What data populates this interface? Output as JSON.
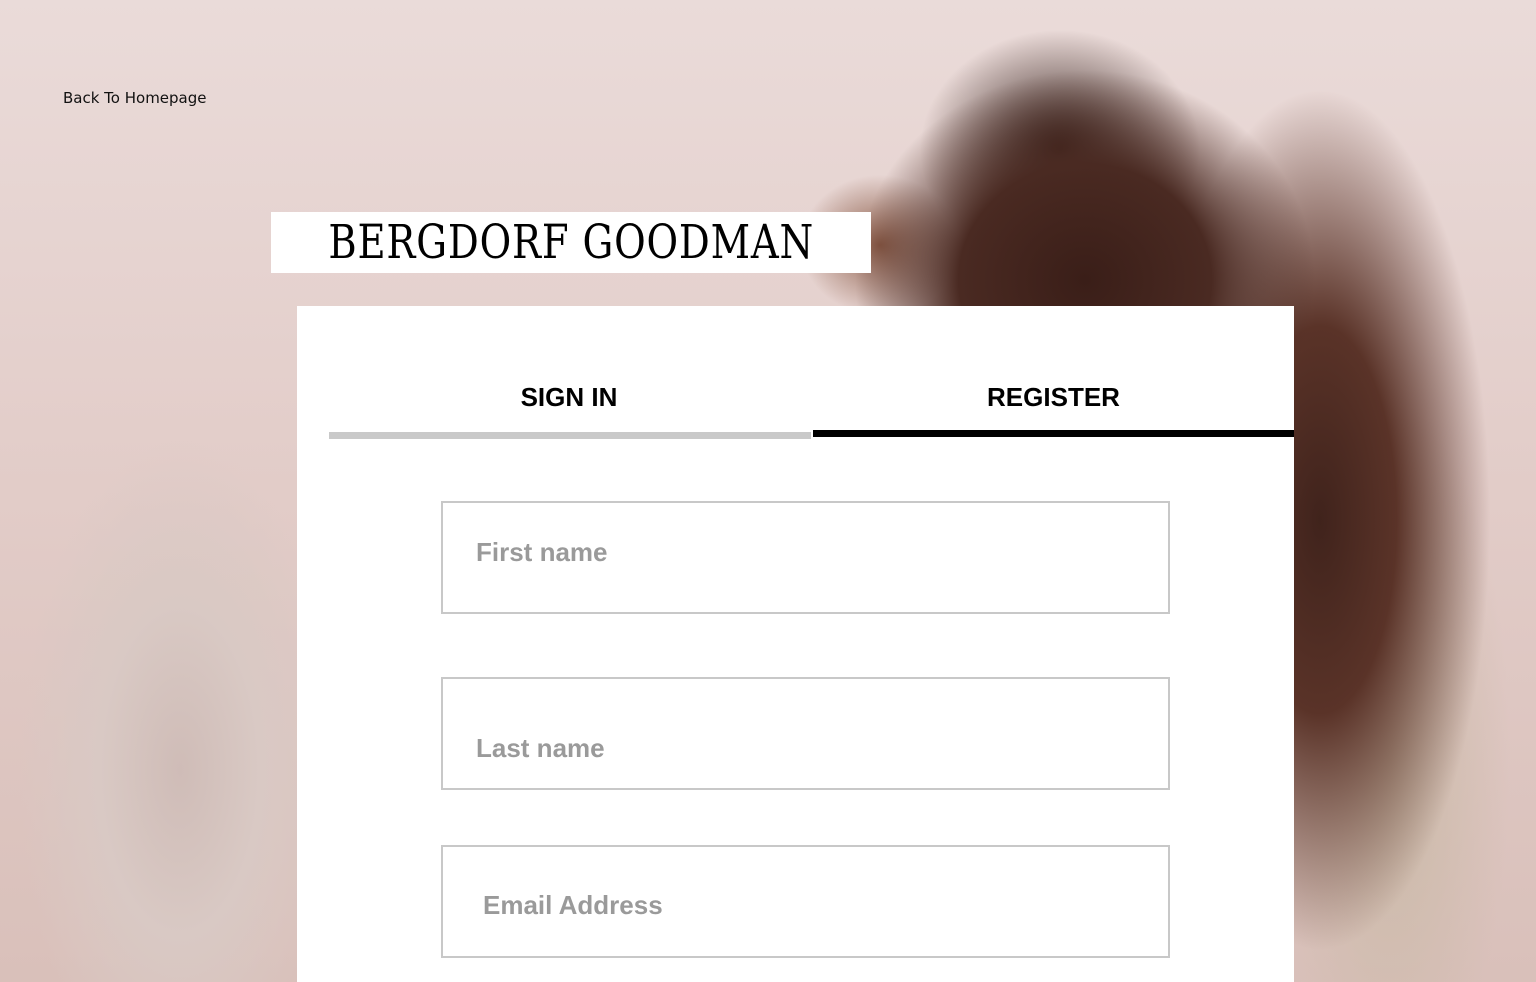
{
  "nav": {
    "back_link": "Back To Homepage"
  },
  "brand": {
    "logo_text": "BERGDORF GOODMAN"
  },
  "tabs": [
    {
      "label": "SIGN IN",
      "active": false
    },
    {
      "label": "REGISTER",
      "active": true
    }
  ],
  "form": {
    "first_name": {
      "placeholder": "First name",
      "value": ""
    },
    "last_name": {
      "placeholder": "Last name",
      "value": ""
    },
    "email": {
      "placeholder": "Email Address",
      "value": ""
    }
  },
  "colors": {
    "active_tab_underline": "#000000",
    "inactive_tab_underline": "#c9c9c9",
    "placeholder": "#9a9a9a"
  }
}
